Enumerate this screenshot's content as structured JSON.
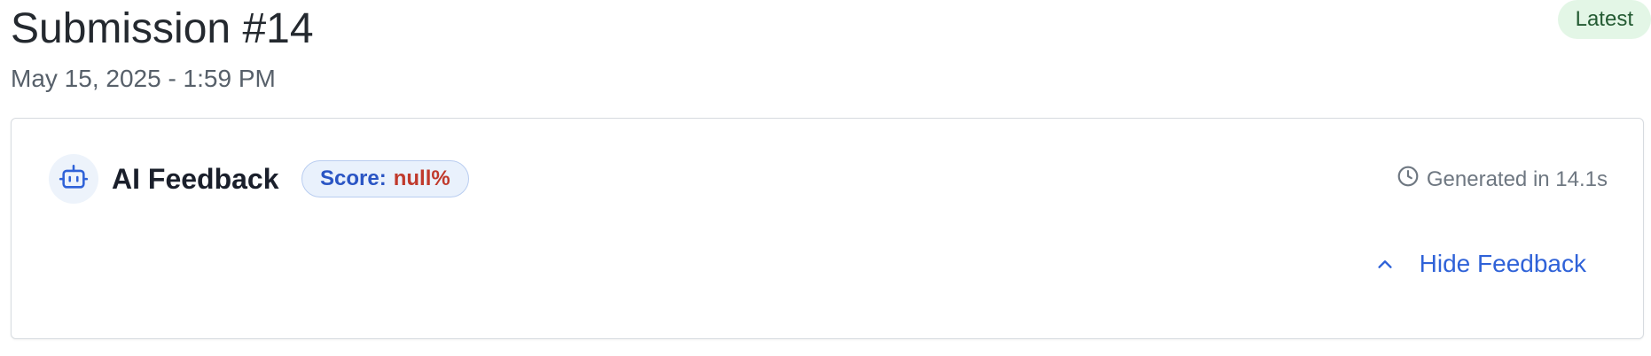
{
  "submission": {
    "title": "Submission #14",
    "date": "May 15, 2025 - 1:59 PM",
    "badge": "Latest"
  },
  "feedback": {
    "icon": "robot-icon",
    "title": "AI Feedback",
    "score_label": "Score:",
    "score_value": "null%",
    "generated_icon": "clock-icon",
    "generated_text": "Generated in 14.1s",
    "toggle_icon": "chevron-up-icon",
    "toggle_label": "Hide Feedback"
  },
  "colors": {
    "badge_bg": "#e3f6e6",
    "badge_text": "#245b33",
    "score_label": "#2a55c4",
    "score_value": "#c0392b",
    "link": "#2f62d8"
  }
}
